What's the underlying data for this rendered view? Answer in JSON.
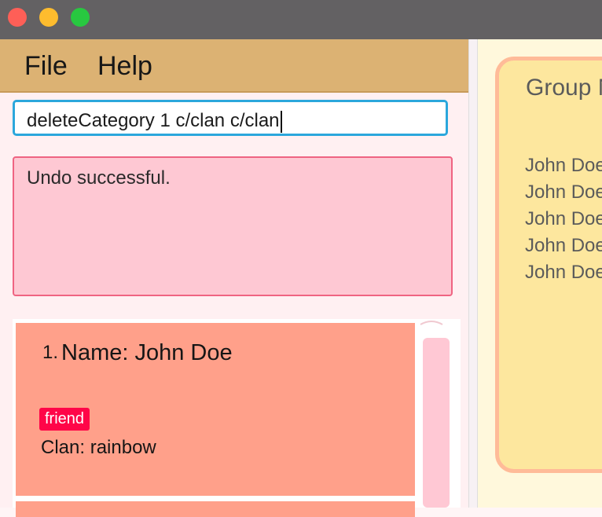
{
  "window": {
    "controls": [
      "close",
      "minimize",
      "maximize"
    ]
  },
  "menu": {
    "file": "File",
    "help": "Help"
  },
  "command": {
    "value": "deleteCategory 1 c/clan c/clan"
  },
  "result": {
    "message": "Undo successful."
  },
  "persons": [
    {
      "index": "1.",
      "name": "Name: John Doe",
      "tag": "friend",
      "clan": "Clan: rainbow"
    }
  ],
  "group_panel": {
    "title": "Group N",
    "members": [
      "John Doe",
      "John Doe",
      "John Doe",
      "John Doe",
      "John Doe"
    ]
  },
  "colors": {
    "accent": "#2ba7dc",
    "menubar": "#dcb273",
    "result_bg": "#fec8d3",
    "card_bg": "#ffa08a",
    "tag_bg": "#ff0548",
    "group_bg": "#fde79e"
  }
}
